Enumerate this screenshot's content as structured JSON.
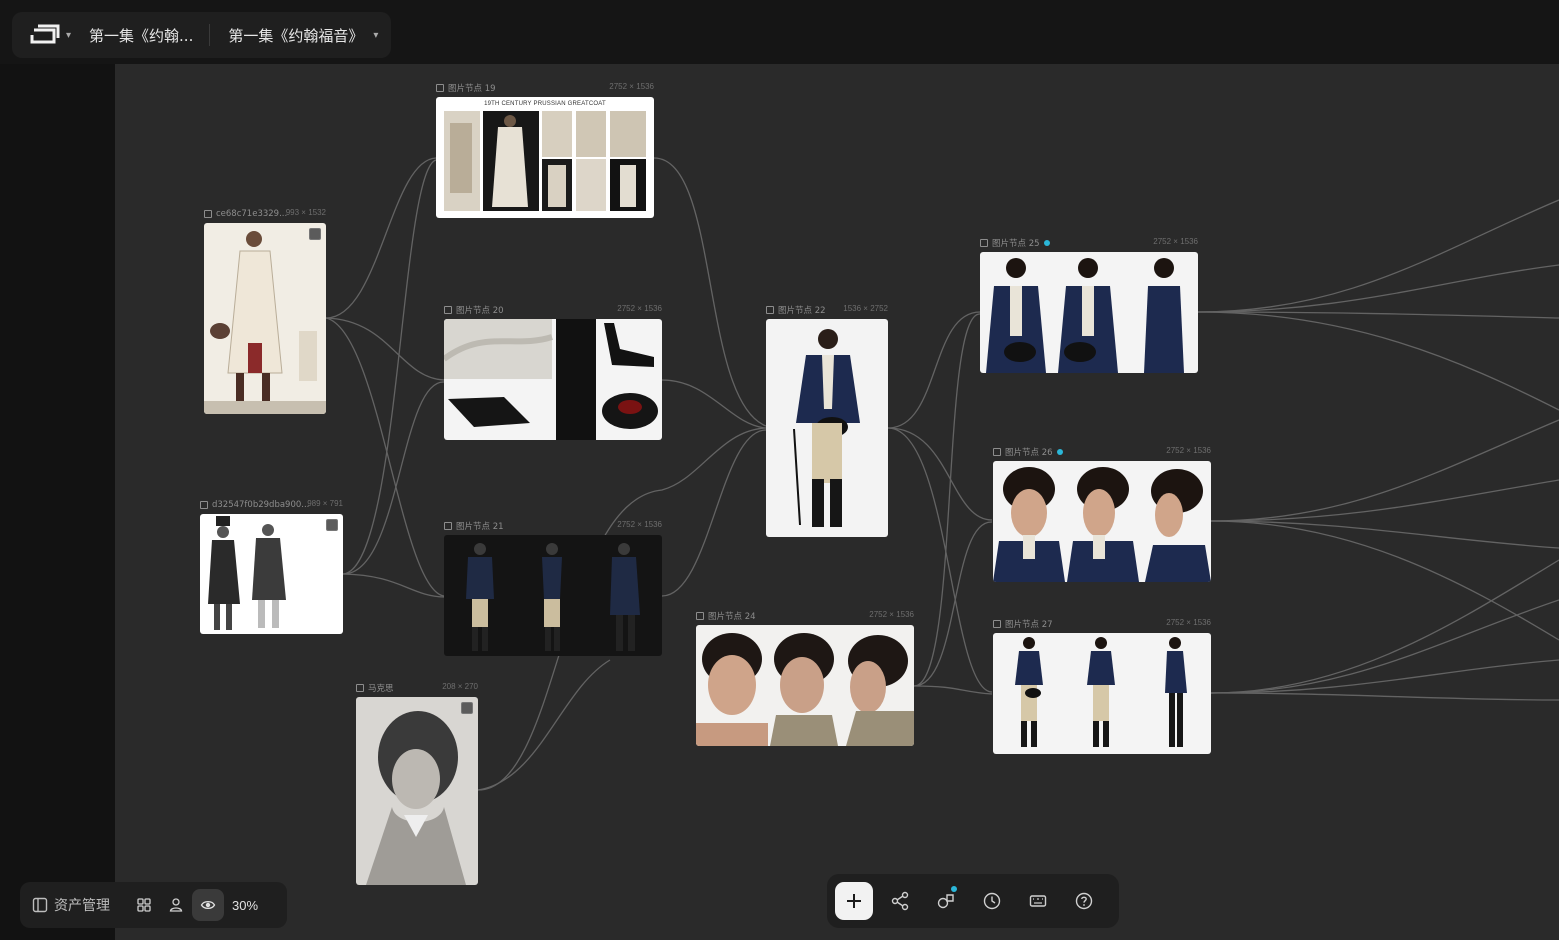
{
  "header": {
    "project_title": "第一集《约翰...",
    "episode_title": "第一集《约翰福音》"
  },
  "nodes": [
    {
      "id": "n-top-sheet",
      "title": "图片节点 19",
      "size": "2752 × 1536",
      "caption": "19TH CENTURY PRUSSIAN GREATCOAT"
    },
    {
      "id": "n-ref1",
      "title": "ce68c71e3329...",
      "size": "993 × 1532"
    },
    {
      "id": "n-ref2",
      "title": "d32547f0b29dba900...",
      "size": "989 × 791"
    },
    {
      "id": "n-marx",
      "title": "马克思",
      "size": "208 × 270"
    },
    {
      "id": "n20",
      "title": "图片节点 20",
      "size": "2752 × 1536"
    },
    {
      "id": "n21",
      "title": "图片节点 21",
      "size": "2752 × 1536"
    },
    {
      "id": "n22",
      "title": "图片节点 22",
      "size": "1536 × 2752"
    },
    {
      "id": "n24",
      "title": "图片节点 24",
      "size": "2752 × 1536"
    },
    {
      "id": "n25",
      "title": "图片节点 25",
      "size": "2752 × 1536"
    },
    {
      "id": "n26",
      "title": "图片节点 26",
      "size": "2752 × 1536"
    },
    {
      "id": "n27",
      "title": "图片节点 27",
      "size": "2752 × 1536"
    }
  ],
  "bottom_left": {
    "asset_label": "资产管理",
    "zoom": "30%"
  },
  "toolbar": {
    "buttons": [
      "plus-icon",
      "share-nodes-icon",
      "shapes-icon",
      "history-icon",
      "keyboard-icon",
      "help-icon"
    ]
  },
  "colors": {
    "canvas": "#2a2a2a",
    "chrome": "#151515",
    "panel": "#1f1f1f",
    "accent": "#2bb7d9",
    "edge": "#6a6a6a"
  }
}
